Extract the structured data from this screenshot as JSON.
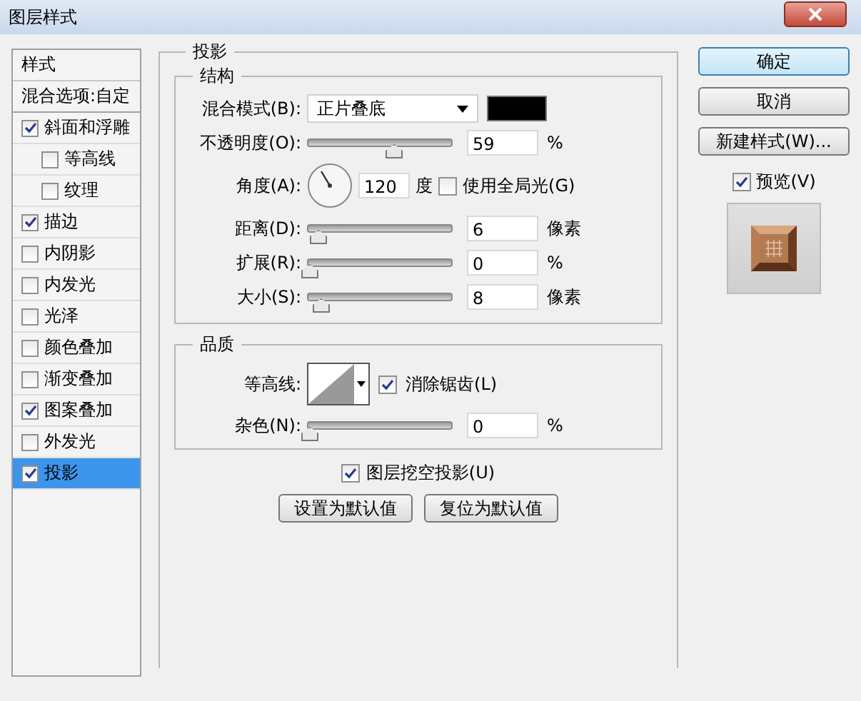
{
  "window": {
    "title": "图层样式"
  },
  "sidebar": {
    "header": "样式",
    "blend_options": "混合选项:自定",
    "items": [
      {
        "label": "斜面和浮雕",
        "checked": true,
        "selected": false,
        "children": [
          {
            "label": "等高线",
            "checked": false,
            "selected": false
          },
          {
            "label": "纹理",
            "checked": false,
            "selected": false
          }
        ]
      },
      {
        "label": "描边",
        "checked": true,
        "selected": false
      },
      {
        "label": "内阴影",
        "checked": false,
        "selected": false
      },
      {
        "label": "内发光",
        "checked": false,
        "selected": false
      },
      {
        "label": "光泽",
        "checked": false,
        "selected": false
      },
      {
        "label": "颜色叠加",
        "checked": false,
        "selected": false
      },
      {
        "label": "渐变叠加",
        "checked": false,
        "selected": false
      },
      {
        "label": "图案叠加",
        "checked": true,
        "selected": false
      },
      {
        "label": "外发光",
        "checked": false,
        "selected": false
      },
      {
        "label": "投影",
        "checked": true,
        "selected": true
      }
    ]
  },
  "panel": {
    "title": "投影",
    "structure": {
      "title": "结构",
      "blend_mode": {
        "label": "混合模式(B):",
        "value": "正片叠底",
        "color": "#000000"
      },
      "opacity": {
        "label": "不透明度(O):",
        "level": 0.59,
        "value": "59",
        "unit": "%"
      },
      "angle": {
        "label": "角度(A):",
        "value": "120",
        "unit": "度",
        "global_light": {
          "label": "使用全局光(G)",
          "checked": false
        }
      },
      "sliders": [
        {
          "label": "距离(D):",
          "level": 0.06,
          "value": "6",
          "unit": "像素"
        },
        {
          "label": "扩展(R):",
          "level": 0,
          "value": "0",
          "unit": "%"
        },
        {
          "label": "大小(S):",
          "level": 0.08,
          "value": "8",
          "unit": "像素"
        }
      ]
    },
    "quality": {
      "title": "品质",
      "contour_label": "等高线:",
      "anti_alias": {
        "label": "消除锯齿(L)",
        "checked": true
      },
      "noise": {
        "label": "杂色(N):",
        "level": 0,
        "value": "0",
        "unit": "%"
      }
    },
    "knockout": {
      "label": "图层挖空投影(U)",
      "checked": true
    },
    "buttons": [
      "设置为默认值",
      "复位为默认值"
    ]
  },
  "actions": {
    "buttons": [
      "确定",
      "取消",
      "新建样式(W)..."
    ],
    "preview": {
      "label": "预览(V)",
      "checked": true
    }
  }
}
